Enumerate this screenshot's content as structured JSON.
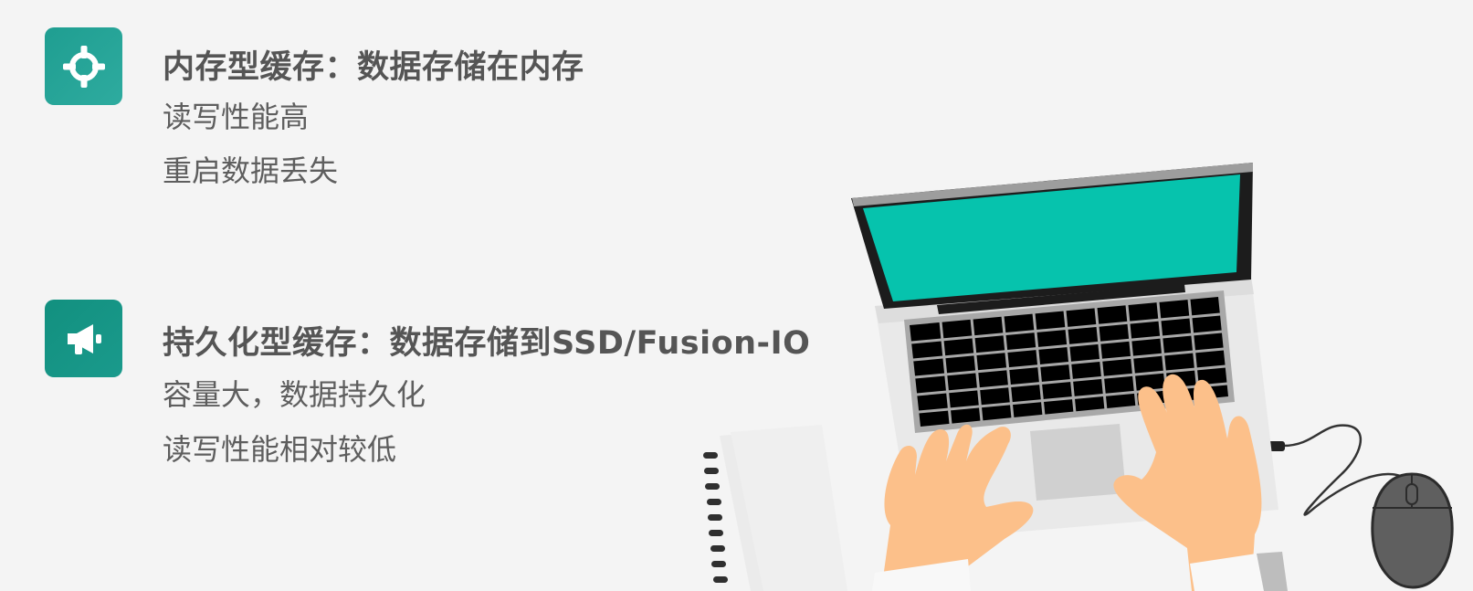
{
  "items": [
    {
      "icon": "crosshair-icon",
      "title": "内存型缓存：数据存储在内存",
      "lines": [
        "读写性能高",
        "重启数据丢失"
      ]
    },
    {
      "icon": "megaphone-icon",
      "title": "持久化型缓存：数据存储到SSD/Fusion-IO",
      "lines": [
        "容量大，数据持久化",
        "读写性能相对较低"
      ]
    }
  ],
  "colors": {
    "accent": "#1f9e91",
    "screen": "#06c3ad",
    "background": "#f4f4f4",
    "text": "#555555"
  }
}
